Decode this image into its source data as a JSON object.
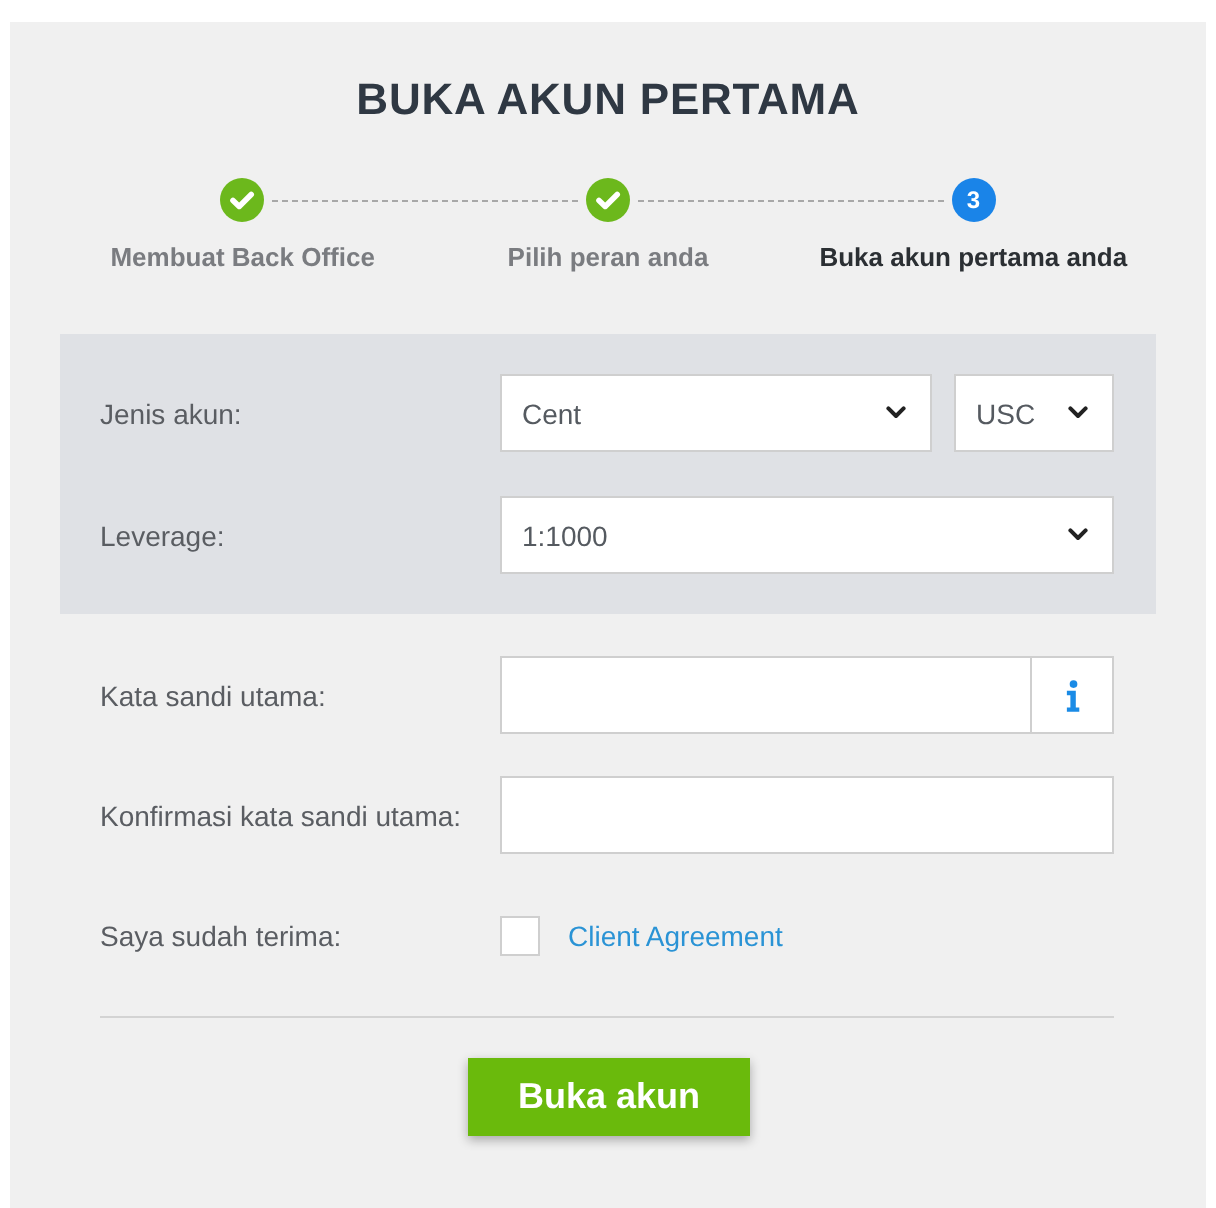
{
  "title": "BUKA AKUN PERTAMA",
  "steps": [
    {
      "label": "Membuat Back Office",
      "done": true,
      "active": false
    },
    {
      "label": "Pilih peran anda",
      "done": true,
      "active": false
    },
    {
      "label": "Buka akun pertama anda",
      "done": false,
      "active": true,
      "number": "3"
    }
  ],
  "account_settings": [
    {
      "label": "Jenis akun:",
      "selects": [
        {
          "value": "Cent"
        },
        {
          "value": "USC"
        }
      ]
    },
    {
      "label": "Leverage:",
      "selects": [
        {
          "value": "1:1000"
        }
      ]
    }
  ],
  "fields": [
    {
      "kind": "password",
      "label": "Kata sandi utama:",
      "info_button": true
    },
    {
      "kind": "password",
      "label": "Konfirmasi kata sandi utama:",
      "info_button": false
    },
    {
      "kind": "checkbox",
      "label": "Saya sudah terima:",
      "checked": false,
      "link": "Client Agreement"
    }
  ],
  "submit_button": "Buka akun"
}
